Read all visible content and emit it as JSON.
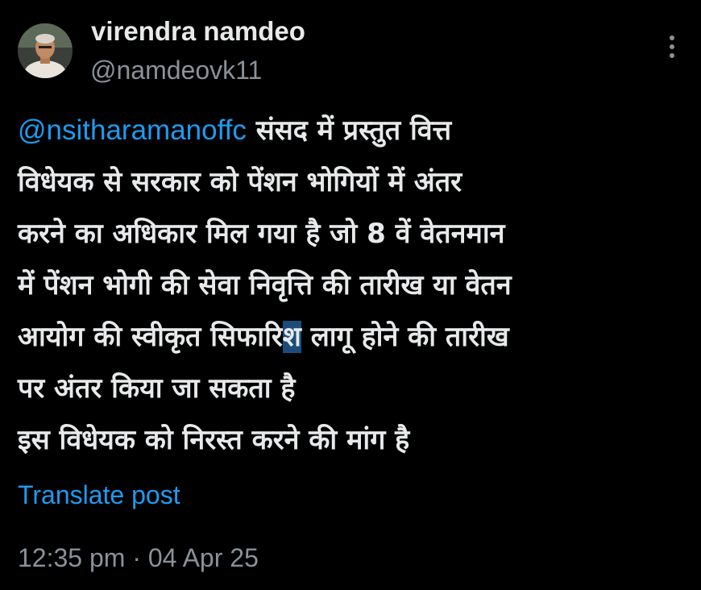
{
  "author": {
    "display_name": "virendra namdeo",
    "handle": "@namdeovk11",
    "avatar_icon": "user-avatar"
  },
  "post": {
    "mention": "@nsitharamanoffc",
    "line1_rest": " संसद में प्रस्तुत वित्त",
    "line2": "विधेयक से सरकार को पेंशन भोगियों में अंतर",
    "line3": "करने का अधिकार मिल गया है जो 8 वें वेतनमान",
    "line4": "में पेंशन भोगी की सेवा निवृत्ति की तारीख या वेतन",
    "line5_a": "आयोग की स्वीकृत सिफारि",
    "line5_sel": "श",
    "line5_b": " लागू होने की तारीख",
    "line6": "पर अंतर किया जा सकता है",
    "line7": "इस विधेयक को निरस्त करने की मांग है"
  },
  "actions": {
    "translate_label": "Translate post",
    "more_icon": "more-options-icon"
  },
  "meta": {
    "timestamp": "12:35 pm · 04 Apr 25"
  },
  "colors": {
    "background": "#000000",
    "text": "#e7e9ea",
    "secondary": "#8b9198",
    "link": "#1d9bf0"
  }
}
